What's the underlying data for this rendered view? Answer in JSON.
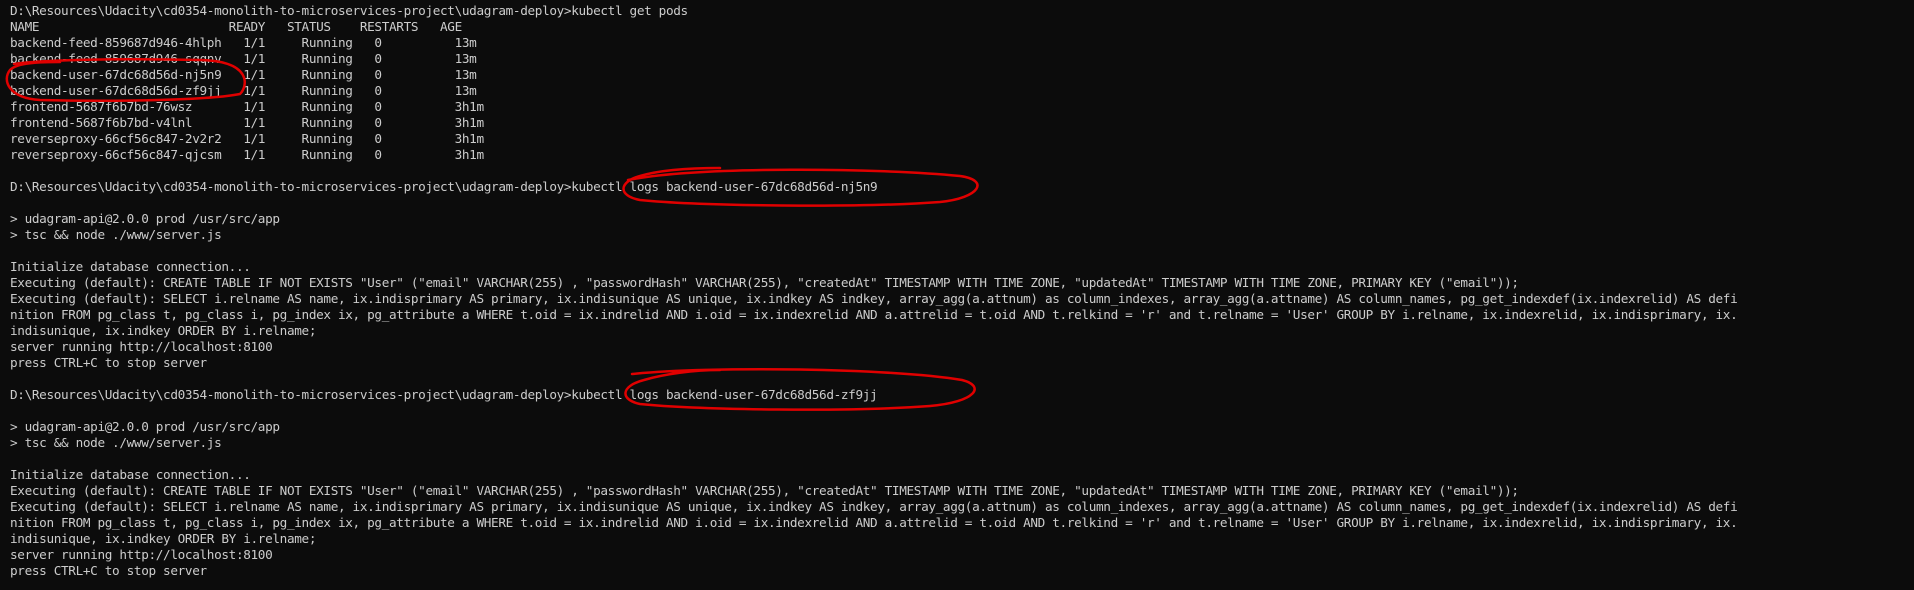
{
  "terminal": {
    "lines": [
      "D:\\Resources\\Udacity\\cd0354-monolith-to-microservices-project\\udagram-deploy>kubectl get pods",
      "NAME                          READY   STATUS    RESTARTS   AGE",
      "backend-feed-859687d946-4hlph   1/1     Running   0          13m",
      "backend-feed-859687d946-sqqnv   1/1     Running   0          13m",
      "backend-user-67dc68d56d-nj5n9   1/1     Running   0          13m",
      "backend-user-67dc68d56d-zf9jj   1/1     Running   0          13m",
      "frontend-5687f6b7bd-76wsz       1/1     Running   0          3h1m",
      "frontend-5687f6b7bd-v4lnl       1/1     Running   0          3h1m",
      "reverseproxy-66cf56c847-2v2r2   1/1     Running   0          3h1m",
      "reverseproxy-66cf56c847-qjcsm   1/1     Running   0          3h1m",
      "",
      "D:\\Resources\\Udacity\\cd0354-monolith-to-microservices-project\\udagram-deploy>kubectl logs backend-user-67dc68d56d-nj5n9",
      "",
      "> udagram-api@2.0.0 prod /usr/src/app",
      "> tsc && node ./www/server.js",
      "",
      "Initialize database connection...",
      "Executing (default): CREATE TABLE IF NOT EXISTS \"User\" (\"email\" VARCHAR(255) , \"passwordHash\" VARCHAR(255), \"createdAt\" TIMESTAMP WITH TIME ZONE, \"updatedAt\" TIMESTAMP WITH TIME ZONE, PRIMARY KEY (\"email\"));",
      "Executing (default): SELECT i.relname AS name, ix.indisprimary AS primary, ix.indisunique AS unique, ix.indkey AS indkey, array_agg(a.attnum) as column_indexes, array_agg(a.attname) AS column_names, pg_get_indexdef(ix.indexrelid) AS defi",
      "nition FROM pg_class t, pg_class i, pg_index ix, pg_attribute a WHERE t.oid = ix.indrelid AND i.oid = ix.indexrelid AND a.attrelid = t.oid AND t.relkind = 'r' and t.relname = 'User' GROUP BY i.relname, ix.indexrelid, ix.indisprimary, ix.",
      "indisunique, ix.indkey ORDER BY i.relname;",
      "server running http://localhost:8100",
      "press CTRL+C to stop server",
      "",
      "D:\\Resources\\Udacity\\cd0354-monolith-to-microservices-project\\udagram-deploy>kubectl logs backend-user-67dc68d56d-zf9jj",
      "",
      "> udagram-api@2.0.0 prod /usr/src/app",
      "> tsc && node ./www/server.js",
      "",
      "Initialize database connection...",
      "Executing (default): CREATE TABLE IF NOT EXISTS \"User\" (\"email\" VARCHAR(255) , \"passwordHash\" VARCHAR(255), \"createdAt\" TIMESTAMP WITH TIME ZONE, \"updatedAt\" TIMESTAMP WITH TIME ZONE, PRIMARY KEY (\"email\"));",
      "Executing (default): SELECT i.relname AS name, ix.indisprimary AS primary, ix.indisunique AS unique, ix.indkey AS indkey, array_agg(a.attnum) as column_indexes, array_agg(a.attname) AS column_names, pg_get_indexdef(ix.indexrelid) AS defi",
      "nition FROM pg_class t, pg_class i, pg_index ix, pg_attribute a WHERE t.oid = ix.indrelid AND i.oid = ix.indexrelid AND a.attrelid = t.oid AND t.relkind = 'r' and t.relname = 'User' GROUP BY i.relname, ix.indexrelid, ix.indisprimary, ix.",
      "indisunique, ix.indkey ORDER BY i.relname;",
      "server running http://localhost:8100",
      "press CTRL+C to stop server"
    ]
  },
  "colors": {
    "background": "#0c0c0c",
    "text": "#cccccc",
    "annotation": "#e00000"
  }
}
